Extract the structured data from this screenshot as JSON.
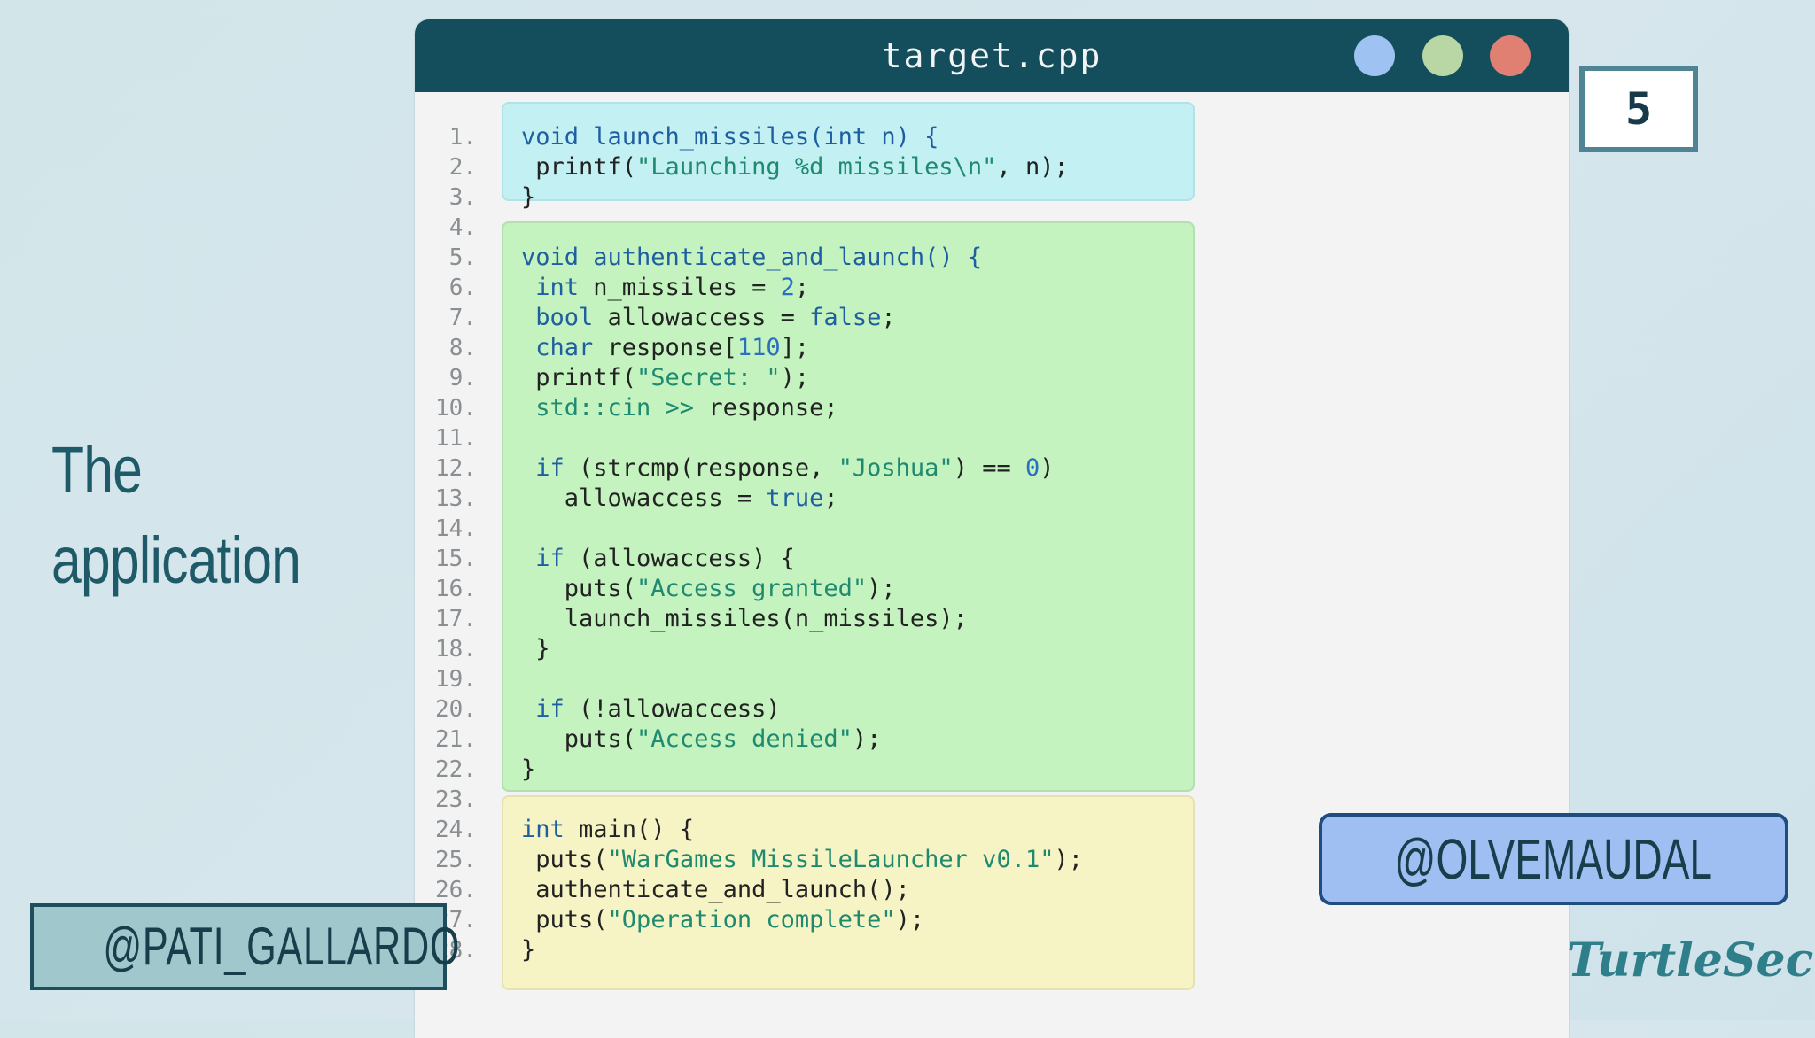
{
  "window": {
    "title": "target.cpp"
  },
  "slide_number": "5",
  "heading": {
    "line1": "The",
    "line2": "application"
  },
  "handles": {
    "left": "@PATI_GALLARDO",
    "right": "@OLVEMAUDAL"
  },
  "brand": "TurtleSec",
  "colors": {
    "titlebar": "#144e5c",
    "block_cyan": "#c2f0f3",
    "block_green": "#c4f3c0",
    "block_yellow": "#f6f4c5"
  },
  "line_numbers": [
    "1.",
    "2.",
    "3.",
    "4.",
    "5.",
    "6.",
    "7.",
    "8.",
    "9.",
    "10.",
    "11.",
    "12.",
    "13.",
    "14.",
    "15.",
    "16.",
    "17.",
    "18.",
    "19.",
    "20.",
    "21.",
    "22.",
    "23.",
    "24.",
    "25.",
    "26.",
    "27.",
    "28."
  ],
  "code": {
    "l1a": "void launch_missiles(int n) {",
    "l2a": " printf(",
    "l2b": "\"Launching %d missiles\\n\"",
    "l2c": ", n);",
    "l3a": "}",
    "l5a": "void authenticate_and_launch() {",
    "l6a": " int",
    "l6b": " n_missiles = ",
    "l6c": "2",
    "l6d": ";",
    "l7a": " bool",
    "l7b": " allowaccess = ",
    "l7c": "false",
    "l7d": ";",
    "l8a": " char",
    "l8b": " response[",
    "l8c": "110",
    "l8d": "];",
    "l9a": " printf(",
    "l9b": "\"Secret: \"",
    "l9c": ");",
    "l10a": " std::cin >>",
    "l10b": " response;",
    "l12a": " if",
    "l12b": " (strcmp(response, ",
    "l12c": "\"Joshua\"",
    "l12d": ") == ",
    "l12e": "0",
    "l12f": ")",
    "l13a": "   allowaccess = ",
    "l13b": "true",
    "l13c": ";",
    "l15a": " if",
    "l15b": " (allowaccess) {",
    "l16a": "   puts(",
    "l16b": "\"Access granted\"",
    "l16c": ");",
    "l17a": "   launch_missiles(n_missiles);",
    "l18a": " }",
    "l20a": " if",
    "l20b": " (!allowaccess)",
    "l21a": "   puts(",
    "l21b": "\"Access denied\"",
    "l21c": ");",
    "l22a": "}",
    "l24a": "int",
    "l24b": " main() {",
    "l25a": " puts(",
    "l25b": "\"WarGames MissileLauncher v0.1\"",
    "l25c": ");",
    "l26a": " authenticate_and_launch();",
    "l27a": " puts(",
    "l27b": "\"Operation complete\"",
    "l27c": ");",
    "l28a": "}"
  }
}
